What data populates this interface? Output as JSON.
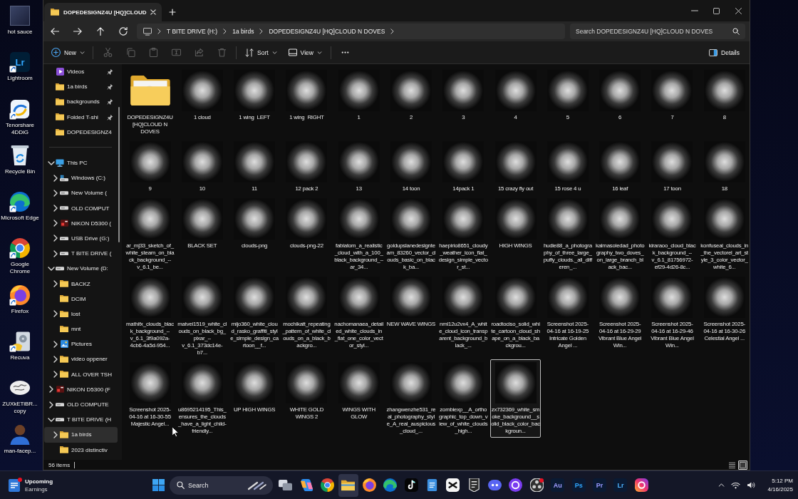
{
  "desktop": {
    "icons": [
      {
        "label": "hot sauce",
        "kind": "photo",
        "shortcut": false
      },
      {
        "label": "Lightroom",
        "kind": "glyph",
        "glyph": "Lr",
        "shortcut": true
      },
      {
        "label": "Tenorshare 4DDiG",
        "kind": "tenorshare",
        "shortcut": true
      },
      {
        "label": "Recycle Bin",
        "kind": "recycle-bin",
        "shortcut": false
      },
      {
        "label": "Microsoft Edge",
        "kind": "edge",
        "shortcut": true
      },
      {
        "label": "Google Chrome",
        "kind": "chrome",
        "shortcut": true
      },
      {
        "label": "Firefox",
        "kind": "firefox",
        "shortcut": true
      },
      {
        "label": "Recuva",
        "kind": "recuva",
        "shortcut": true
      },
      {
        "label": "ZUXkETiBR... copy",
        "kind": "sketch",
        "shortcut": false
      },
      {
        "label": "man-facep...",
        "kind": "person",
        "shortcut": false
      }
    ]
  },
  "window": {
    "tab": {
      "title": "DOPEDESIGNZ4U [HQ]CLOUD"
    },
    "address_bar": {
      "segments": [
        "T BITE DRIVE (H:)",
        "1a birds",
        "DOPEDESIGNZ4U [HQ]CLOUD N DOVES"
      ]
    },
    "search": {
      "placeholder": "Search DOPEDESIGNZ4U [HQ]CLOUD N DOVES"
    },
    "command_bar": {
      "new": "New",
      "edit_actions_disabled": true,
      "sort": "Sort",
      "view": "View",
      "details": "Details"
    },
    "nav_pane": {
      "pinned": [
        {
          "label": "Videos",
          "kind": "videos",
          "pinned": true,
          "selected": false
        },
        {
          "label": "1a birds",
          "kind": "folder",
          "pinned": true,
          "selected": false
        },
        {
          "label": "backgrounds",
          "kind": "folder",
          "pinned": true,
          "selected": false
        },
        {
          "label": "Folded T-shi",
          "kind": "folder",
          "pinned": true,
          "selected": false
        },
        {
          "label": "DOPEDESIGNZ4",
          "kind": "folder",
          "pinned": false,
          "selected": false
        }
      ],
      "tree": [
        {
          "label": "This PC",
          "kind": "pc",
          "expandable": true,
          "expanded": true,
          "selected": false,
          "children": [
            {
              "label": "Windows (C:)",
              "kind": "system-drive",
              "expandable": true,
              "expanded": false,
              "selected": false
            },
            {
              "label": "New Volume (",
              "kind": "drive",
              "expandable": true,
              "expanded": false,
              "selected": false
            },
            {
              "label": "OLD COMPUT",
              "kind": "drive",
              "expandable": true,
              "expanded": false,
              "selected": false
            },
            {
              "label": "NIKON D5300 (",
              "kind": "camera-drive",
              "expandable": true,
              "expanded": false,
              "selected": false
            },
            {
              "label": "USB Drive (G:)",
              "kind": "drive",
              "expandable": true,
              "expanded": false,
              "selected": false
            },
            {
              "label": "T BITE DRIVE (",
              "kind": "drive",
              "expandable": true,
              "expanded": false,
              "selected": false
            }
          ]
        },
        {
          "label": "New Volume (D:",
          "kind": "drive",
          "expandable": true,
          "expanded": true,
          "selected": false,
          "children": [
            {
              "label": "BACKZ",
              "kind": "folder",
              "expandable": true,
              "expanded": false,
              "selected": false
            },
            {
              "label": "DCIM",
              "kind": "folder",
              "expandable": false,
              "selected": false
            },
            {
              "label": "lost",
              "kind": "folder",
              "expandable": true,
              "expanded": false,
              "selected": false
            },
            {
              "label": "mnt",
              "kind": "folder",
              "expandable": false,
              "selected": false
            },
            {
              "label": "Pictures",
              "kind": "pictures",
              "expandable": true,
              "expanded": false,
              "selected": false
            },
            {
              "label": "video oppener",
              "kind": "folder",
              "expandable": true,
              "expanded": false,
              "selected": false
            },
            {
              "label": "ALL OVER TSH",
              "kind": "folder",
              "expandable": true,
              "expanded": false,
              "selected": false
            }
          ]
        },
        {
          "label": "NIKON D5300 (F",
          "kind": "camera-drive",
          "expandable": true,
          "expanded": false,
          "selected": false
        },
        {
          "label": "OLD COMPUTE",
          "kind": "drive",
          "expandable": true,
          "expanded": false,
          "selected": false
        },
        {
          "label": "T BITE DRIVE (H",
          "kind": "drive",
          "expandable": true,
          "expanded": true,
          "selected": false,
          "children": [
            {
              "label": "1a birds",
              "kind": "folder",
              "expandable": true,
              "expanded": false,
              "selected": true
            },
            {
              "label": "2023 distinctiv",
              "kind": "folder",
              "expandable": false,
              "selected": false
            }
          ]
        }
      ]
    },
    "items": [
      {
        "label": "DOPEDESIGNZ4U [HQ]CLOUD N DOVES",
        "kind": "folder",
        "selected": false
      },
      {
        "label": "1 cloud",
        "kind": "image",
        "selected": false
      },
      {
        "label": "1 wing  LEFT",
        "kind": "image",
        "selected": false
      },
      {
        "label": "1 wing  RIGHT",
        "kind": "image",
        "selected": false
      },
      {
        "label": "1",
        "kind": "image",
        "selected": false
      },
      {
        "label": "2",
        "kind": "image",
        "selected": false
      },
      {
        "label": "3",
        "kind": "image",
        "selected": false
      },
      {
        "label": "4",
        "kind": "image",
        "selected": false
      },
      {
        "label": "5",
        "kind": "image",
        "selected": false
      },
      {
        "label": "6",
        "kind": "image",
        "selected": false
      },
      {
        "label": "7",
        "kind": "image",
        "selected": false
      },
      {
        "label": "8",
        "kind": "image",
        "selected": false
      },
      {
        "label": "9",
        "kind": "image",
        "selected": false
      },
      {
        "label": "10",
        "kind": "image",
        "selected": false
      },
      {
        "label": "11",
        "kind": "image",
        "selected": false
      },
      {
        "label": "12 pack 2",
        "kind": "image",
        "selected": false
      },
      {
        "label": "13",
        "kind": "image",
        "selected": false
      },
      {
        "label": "14 toon",
        "kind": "image",
        "selected": false
      },
      {
        "label": "14pack 1",
        "kind": "image",
        "selected": false
      },
      {
        "label": "15 crazy fly out",
        "kind": "image",
        "selected": false
      },
      {
        "label": "15 rose 4 u",
        "kind": "image",
        "selected": false
      },
      {
        "label": "16 leaf",
        "kind": "image",
        "selected": false
      },
      {
        "label": "17 toon",
        "kind": "image",
        "selected": false
      },
      {
        "label": "18",
        "kind": "image",
        "selected": false
      },
      {
        "label": "ar_mj33_sketch_of_white_steam_on_black_background_--v_6.1_be...",
        "kind": "image",
        "selected": false
      },
      {
        "label": "BLACK SET",
        "kind": "image",
        "selected": false
      },
      {
        "label": "clouds-png",
        "kind": "image",
        "selected": false
      },
      {
        "label": "clouds-png-22",
        "kind": "image",
        "selected": false
      },
      {
        "label": "fabiatom_a_realistic_cloud_with_a_100_black_background_--ar_34...",
        "kind": "image",
        "selected": false
      },
      {
        "label": "goldupslanedesignteam_83260_vector_clouds_basic_on_black_ba...",
        "kind": "image",
        "selected": false
      },
      {
        "label": "haepirio8651_cloudy_weather_icon_flat_design_simple_vector_st...",
        "kind": "image",
        "selected": false
      },
      {
        "label": "HIGH WINGS",
        "kind": "image",
        "selected": false
      },
      {
        "label": "hudie88_a_photography_of_three_large_puffy_clouds._all_differen_...",
        "kind": "image",
        "selected": false
      },
      {
        "label": "kalmasoledad_photography_two_doves_on_large_branch_black_bac...",
        "kind": "image",
        "selected": false
      },
      {
        "label": "kiraraoo_cloud_black_background_--v_6.1_81756972-ef29-4d26-8c...",
        "kind": "image",
        "selected": false
      },
      {
        "label": "konfuseai_clouds_in_the_vectorel_art_style_3_color_vector_white_6...",
        "kind": "image",
        "selected": false
      },
      {
        "label": "mathifx_clouds_black_background_--v_6.1_3f9a092a-4cb6-4a5d-954...",
        "kind": "image",
        "selected": false
      },
      {
        "label": "matvei1519_white_clouds_on_black_bg_pixar_--v_6.1_373dc14e-b7...",
        "kind": "image",
        "selected": false
      },
      {
        "label": "mijo360_white_cloud_rasko_graffiti_style_simple_design_cartoon__f...",
        "kind": "image",
        "selected": false
      },
      {
        "label": "mochikatt_repeating_pattern_of_white_clouds_on_a_black_backgro...",
        "kind": "image",
        "selected": false
      },
      {
        "label": "nachomanaea_detailed_white_clouds_in_flat_one_color_vector_styl...",
        "kind": "image",
        "selected": false
      },
      {
        "label": "NEW WAVE WINGS",
        "kind": "image",
        "selected": false
      },
      {
        "label": "nml12u2vx4_A_white_cloud_icon_transparent_background_black_...",
        "kind": "image",
        "selected": false
      },
      {
        "label": "roadtociso_solid_white_cartoon_cloud_shape_on_a_black_backgrou...",
        "kind": "image",
        "selected": false
      },
      {
        "label": "Screenshot 2025-04-16 at 16-19-25 Intricate Golden Angel ...",
        "kind": "image",
        "selected": false
      },
      {
        "label": "Screenshot 2025-04-16 at 16-29-29 Vibrant Blue Angel Win...",
        "kind": "image",
        "selected": false
      },
      {
        "label": "Screenshot 2025-04-16 at 16-29-46 Vibrant Blue Angel Win...",
        "kind": "image",
        "selected": false
      },
      {
        "label": "Screenshot 2025-04-16 at 16-30-26 Celestial Angel ...",
        "kind": "image",
        "selected": false
      },
      {
        "label": "Screenshot 2025-04-16 at 16-30-55 Majestic Angel...",
        "kind": "image",
        "selected": false
      },
      {
        "label": "u8695214195_This_ensures_the_clouds_have_a_light_child-friendly...",
        "kind": "image",
        "selected": false
      },
      {
        "label": "UP HIGH WINGS",
        "kind": "image",
        "selected": false
      },
      {
        "label": "WHITE GOLD WINGS 2",
        "kind": "image",
        "selected": false
      },
      {
        "label": "WINGS WITH GLOW",
        "kind": "image",
        "selected": false
      },
      {
        "label": "zhangwenzhe531_real_photography_style_A_real_auspicious_cloud_...",
        "kind": "image",
        "selected": false
      },
      {
        "label": "zombiexp__A_orthographic_top_down_view_of_white_clouds_high...",
        "kind": "image",
        "selected": false
      },
      {
        "label": "zx732369_white_smoke_background__solid_black_color_backgroun...",
        "kind": "image",
        "selected": true
      }
    ],
    "status_bar": {
      "count": "56 items",
      "views": [
        {
          "kind": "details",
          "selected": false
        },
        {
          "kind": "large-icons",
          "selected": true
        }
      ]
    }
  },
  "taskbar": {
    "widget": {
      "title": "Upcoming",
      "subtitle": "Earnings",
      "notification": true
    },
    "search": {
      "placeholder": "Search"
    },
    "apps": [
      {
        "kind": "task-view",
        "active": false,
        "notification": false
      },
      {
        "kind": "copilot",
        "active": false,
        "notification": false
      },
      {
        "kind": "chrome",
        "active": false,
        "notification": false
      },
      {
        "kind": "file-explorer",
        "active": true,
        "notification": false
      },
      {
        "kind": "firefox",
        "active": false,
        "notification": false
      },
      {
        "kind": "edge",
        "active": false,
        "notification": false
      },
      {
        "kind": "tiktok",
        "active": false,
        "notification": false
      },
      {
        "kind": "notepad",
        "active": false,
        "notification": false
      },
      {
        "kind": "capcut",
        "active": false,
        "notification": false
      },
      {
        "kind": "shield",
        "active": false,
        "notification": false
      },
      {
        "kind": "discord",
        "active": false,
        "notification": false
      },
      {
        "kind": "ring",
        "active": false,
        "notification": false
      },
      {
        "kind": "lens",
        "active": false,
        "notification": true
      },
      {
        "kind": "glyph",
        "text": "Au",
        "color": "#a09cff",
        "active": false,
        "notification": false
      },
      {
        "kind": "glyph",
        "text": "Ps",
        "color": "#31a8ff",
        "active": false,
        "notification": false
      },
      {
        "kind": "glyph",
        "text": "Pr",
        "color": "#9999ff",
        "active": false,
        "notification": false
      },
      {
        "kind": "glyph",
        "text": "Lr",
        "color": "#4fb3ff",
        "active": false,
        "notification": false
      },
      {
        "kind": "gradient-square",
        "active": false,
        "notification": false
      }
    ],
    "clock": {
      "time": "5:12 PM",
      "date": "4/16/2025"
    }
  }
}
